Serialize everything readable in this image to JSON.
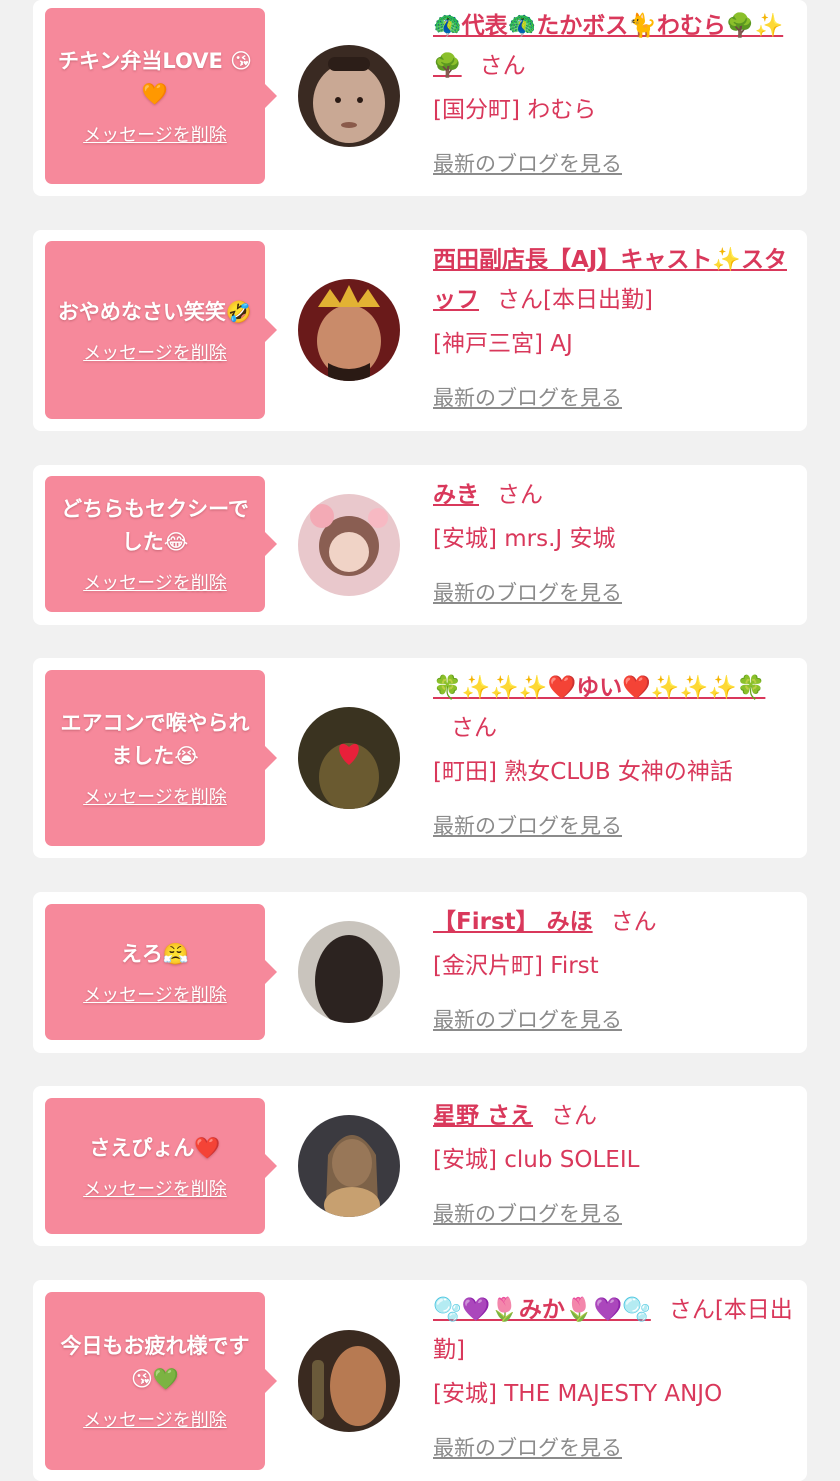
{
  "colors": {
    "bubble": "#f6899b",
    "accent": "#d9385b",
    "link_gray": "#8b8b8b",
    "background": "#f1f1f1"
  },
  "delete_label": "メッセージを削除",
  "blog_label": "最新のブログを見る",
  "cards": [
    {
      "message": "チキン弁当LOVE 😘🧡",
      "name": "🦚代表🦚たかボス🐈わむら🌳✨🌳",
      "suffix": "さん",
      "shop": "[国分町] わむら"
    },
    {
      "message": "おやめなさい笑笑🤣",
      "name": "西田副店長【AJ】キャスト✨スタッフ",
      "suffix": "さん[本日出勤]",
      "shop": "[神戸三宮] AJ"
    },
    {
      "message": "どちらもセクシーでした😂",
      "name": "みき",
      "suffix": "さん",
      "shop": "[安城] mrs.J 安城"
    },
    {
      "message": "エアコンで喉やられました😭",
      "name": "🍀✨✨✨❤️ゆい❤️✨✨✨🍀",
      "suffix": "さん",
      "shop": "[町田] 熟女CLUB 女神の神話"
    },
    {
      "message": "えろ😤",
      "name": "【First】 みほ",
      "suffix": "さん",
      "shop": "[金沢片町] First"
    },
    {
      "message": "さえぴょん❤️",
      "name": "星野 さえ",
      "suffix": "さん",
      "shop": "[安城] club SOLEIL"
    },
    {
      "message": "今日もお疲れ様です😘💚",
      "name": "🫧💜🌷みか🌷💜🫧",
      "suffix": "さん[本日出勤]",
      "shop": "[安城] THE MAJESTY ANJO"
    }
  ]
}
